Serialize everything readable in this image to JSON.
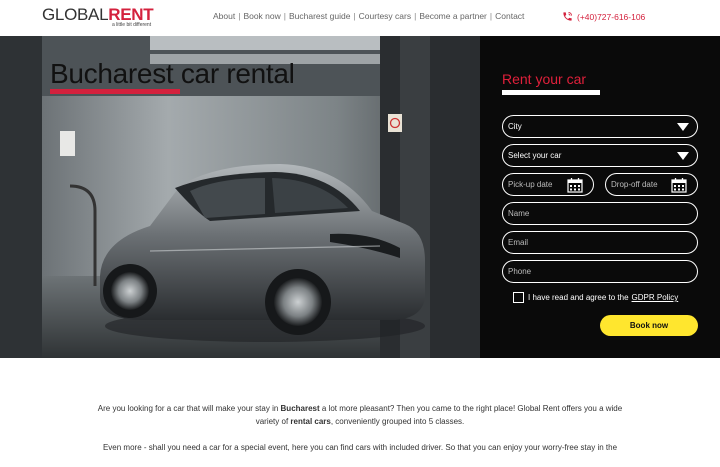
{
  "header": {
    "logo_part1": "GLOBAL",
    "logo_part2": "RENT",
    "tagline": "a little bit different",
    "nav": [
      "About",
      "Book now",
      "Bucharest guide",
      "Courtesy cars",
      "Become a partner",
      "Contact"
    ],
    "phone": "(+40)727-616-106"
  },
  "hero": {
    "title": "Bucharest car rental",
    "accent_color": "#d4213d"
  },
  "form": {
    "title": "Rent your car",
    "city_value": "City",
    "car_value": "Select your car",
    "pickup_placeholder": "Pick-up date",
    "dropoff_placeholder": "Drop-off date",
    "name_placeholder": "Name",
    "email_placeholder": "Email",
    "phone_placeholder": "Phone",
    "gdpr_text": "I have read and agree to the",
    "gdpr_link": "GDPR Policy",
    "book_label": "Book now",
    "button_color": "#ffe62e"
  },
  "intro": {
    "p1_a": "Are you looking for a car that will make your stay in ",
    "p1_b": "Bucharest",
    "p1_c": " a lot more pleasant? Then you came to the right place! Global Rent offers you a wide",
    "p1_d": "variety of ",
    "p1_e": "rental cars",
    "p1_f": ", conveniently grouped into 5 classes.",
    "p2": "Even more - shall you need a car for a special event, here you can find cars with included driver. So that you can enjoy your worry-free stay in the"
  }
}
